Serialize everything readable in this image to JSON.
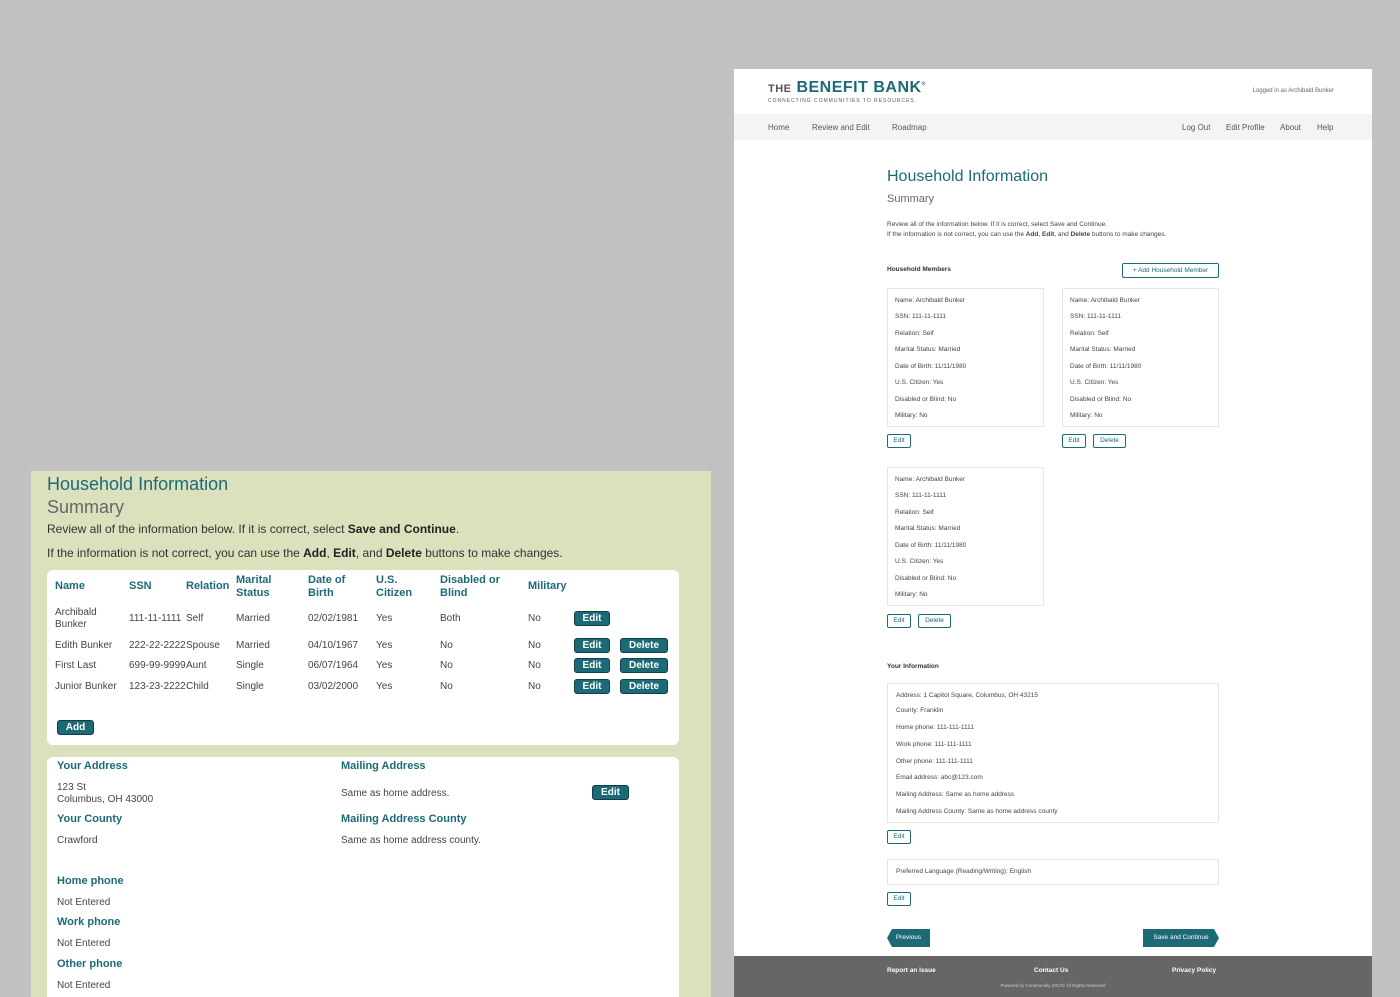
{
  "old": {
    "title": "Household Information",
    "subtitle": "Summary",
    "review_pre": "Review all of the information below. If it is correct, select ",
    "review_bold": "Save and Continue",
    "review_post": ".",
    "incorrect_pre": "If the information is not correct, you can use the ",
    "incorrect_add": "Add",
    "incorrect_edit": "Edit",
    "incorrect_and": ", and ",
    "incorrect_delete": "Delete",
    "incorrect_post": " buttons to make changes.",
    "comma": ", ",
    "headers": {
      "name": "Name",
      "ssn": "SSN",
      "relation": "Relation",
      "marital1": "Marital",
      "marital2": "Status",
      "dob1": "Date of",
      "dob2": "Birth",
      "citizen1": "U.S.",
      "citizen2": "Citizen",
      "disabled1": "Disabled or",
      "disabled2": "Blind",
      "military": "Military"
    },
    "rows": [
      {
        "name1": "Archibald",
        "name2": "Bunker",
        "ssn": "111-11-1111",
        "relation": "Self",
        "marital": "Married",
        "dob": "02/02/1981",
        "citizen": "Yes",
        "disabled": "Both",
        "military": "No",
        "edit": "Edit"
      },
      {
        "name1": "Edith Bunker",
        "ssn": "222-22-2222",
        "relation": "Spouse",
        "marital": "Married",
        "dob": "04/10/1967",
        "citizen": "Yes",
        "disabled": "No",
        "military": "No",
        "edit": "Edit",
        "delete": "Delete"
      },
      {
        "name1": "First Last",
        "ssn": "699-99-9999",
        "relation": "Aunt",
        "marital": "Single",
        "dob": "06/07/1964",
        "citizen": "Yes",
        "disabled": "No",
        "military": "No",
        "edit": "Edit",
        "delete": "Delete"
      },
      {
        "name1": "Junior Bunker",
        "ssn": "123-23-2222",
        "relation": "Child",
        "marital": "Single",
        "dob": "03/02/2000",
        "citizen": "Yes",
        "disabled": "No",
        "military": "No",
        "edit": "Edit",
        "delete": "Delete"
      }
    ],
    "add_label": "Add",
    "address": {
      "your_address_label": "Your Address",
      "address_line1": "123 St",
      "address_line2": "Columbus, OH 43000",
      "mailing_label": "Mailing Address",
      "mailing_value": "Same as home address.",
      "edit": "Edit",
      "county_label": "Your County",
      "county_value": "Crawford",
      "mailing_county_label": "Mailing Address County",
      "mailing_county_value": "Same as home address county.",
      "home_phone_label": "Home phone",
      "home_phone_value": "Not Entered",
      "work_phone_label": "Work phone",
      "work_phone_value": "Not Entered",
      "other_phone_label": "Other phone",
      "other_phone_value": "Not Entered"
    }
  },
  "new": {
    "logo_the": "THE",
    "logo_main": "BENEFIT BANK",
    "logo_reg": "®",
    "logo_tagline": "CONNECTING COMMUNITIES TO RESOURCES",
    "logged_in": "Logged in as Archibald Bunker",
    "nav_left": [
      "Home",
      "Review and Edit",
      "Roadmap"
    ],
    "nav_right": [
      "Log Out",
      "Edit Profile",
      "About",
      "Help"
    ],
    "title": "Household Information",
    "subtitle": "Summary",
    "desc1": "Review all of the information below. If it is correct, select Save and Continue.",
    "desc2_pre": "If the information is not correct, you can use the ",
    "desc2_add": "Add",
    "desc2_edit": "Edit",
    "desc2_delete": "Delete",
    "desc2_and": ", and ",
    "desc2_post": " buttons to make changes.",
    "comma": ", ",
    "members_label": "Household Members",
    "add_member": "+ Add Household Member",
    "members": [
      {
        "rows": [
          "Name:  Archibald Bunker",
          "SSN:  111-11-1111",
          "Relation:  Self",
          "Marital Status:  Married",
          "Date of Birth:  11/11/1980",
          "U.S. Citizen:  Yes",
          "Disabled or Blind:  No",
          "Military:  No"
        ],
        "edit": "Edit"
      },
      {
        "rows": [
          "Name:  Archibald Bunker",
          "SSN:  111-11-1111",
          "Relation:  Self",
          "Marital Status:  Married",
          "Date of Birth:  11/11/1980",
          "U.S. Citizen:  Yes",
          "Disabled or Blind:  No",
          "Military:  No"
        ],
        "edit": "Edit",
        "delete": "Delete"
      },
      {
        "rows": [
          "Name:  Archibald Bunker",
          "SSN:  111-11-1111",
          "Relation:  Self",
          "Marital Status:  Married",
          "Date of Birth:  11/11/1980",
          "U.S. Citizen:  Yes",
          "Disabled or Blind:  No",
          "Military:  No"
        ],
        "edit": "Edit",
        "delete": "Delete"
      }
    ],
    "your_info_label": "Your Information",
    "info_rows": [
      "Address:  1 Capitol Square, Columbus, OH 43215",
      "County:  Franklin",
      "Home phone:  111-111-1111",
      "Work phone:  111-111-1111",
      "Other phone:  111-111-1111",
      "Email address:  abc@123.com",
      "Mailing Address:  Same as home address",
      "Mailing Address County:  Same as home address county"
    ],
    "info_edit": "Edit",
    "language": "Preferred Language (Reading/Writing):  English",
    "language_edit": "Edit",
    "previous": "Previous",
    "save_continue": "Save and Continue",
    "footer": {
      "report": "Report an Issue",
      "contact": "Contact Us",
      "privacy": "Privacy Policy",
      "copyright": "Powered by Communally    2017© All Rights Reserved"
    }
  }
}
